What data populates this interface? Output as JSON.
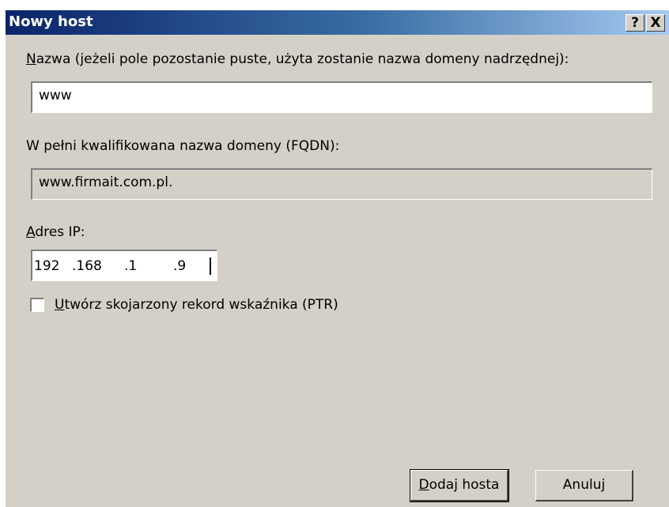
{
  "dialog": {
    "title": "Nowy host",
    "help_button": "?",
    "close_button": "X"
  },
  "name": {
    "label_accel": "N",
    "label_rest": "azwa (jeżeli pole pozostanie puste, użyta zostanie nazwa domeny nadrzędnej):",
    "value": "www"
  },
  "fqdn": {
    "label": "W pełni kwalifikowana nazwa domeny (FQDN):",
    "value": "www.firmait.com.pl."
  },
  "ip": {
    "label_accel": "A",
    "label_rest": "dres IP:",
    "octets": [
      "192",
      ".168",
      ".1",
      ".9"
    ]
  },
  "ptr": {
    "checked": false,
    "label_accel": "U",
    "label_rest": "twórz skojarzony rekord wskaźnika (PTR)"
  },
  "buttons": {
    "add_accel": "D",
    "add_rest": "odaj hosta",
    "cancel": "Anuluj"
  }
}
